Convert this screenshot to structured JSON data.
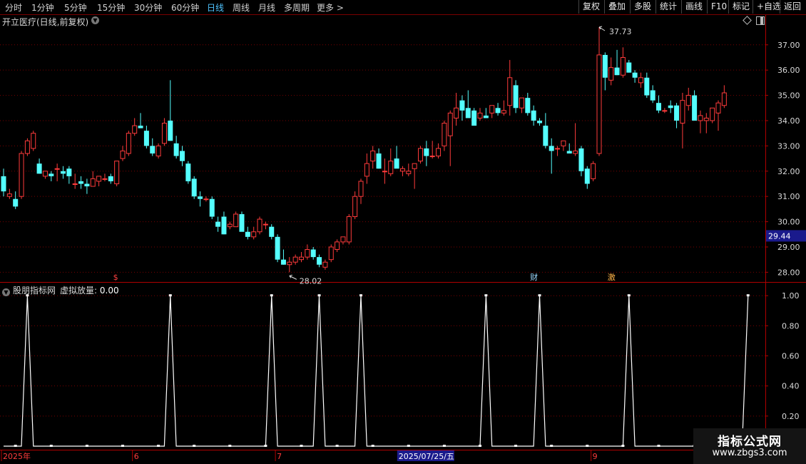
{
  "toolbar": {
    "periods": [
      "分时",
      "1分钟",
      "5分钟",
      "15分钟",
      "30分钟",
      "60分钟",
      "日线",
      "周线",
      "月线",
      "多周期",
      "更多 >"
    ],
    "active_period": "日线",
    "tools": [
      "复权",
      "叠加",
      "多股",
      "统计",
      "画线",
      "F10",
      "标记",
      "+自选",
      "返回"
    ]
  },
  "stock": {
    "title": "开立医疗(日线,前复权)"
  },
  "indicator": {
    "source": "股朋指标网",
    "name": "虚拟放量:",
    "value": "0.00"
  },
  "colors": {
    "up": "#ff3b3b",
    "down": "#54ffff",
    "grid": "#7a0000",
    "axis_text": "#d9d9d9",
    "line": "#ffffff"
  },
  "watermark": {
    "line1": "指标公式网",
    "line2": "www.zbgs3.com"
  },
  "chart_data": [
    {
      "type": "candlestick",
      "ylim": [
        27.7,
        37.7
      ],
      "y_ticks": [
        "28.00",
        "29.00",
        "30.00",
        "31.00",
        "32.00",
        "33.00",
        "34.00",
        "35.00",
        "36.00",
        "37.00"
      ],
      "price_marker": "29.44",
      "high_label": "37.73",
      "low_label": "28.02",
      "markers": [
        {
          "text": "$",
          "index": 19,
          "color": "#ff4040"
        },
        {
          "text": "财",
          "index": 89,
          "color": "#9ad8ff"
        },
        {
          "text": "激",
          "index": 102,
          "color": "#ffb347"
        }
      ],
      "candles": [
        [
          31.8,
          32.1,
          31.0,
          31.2
        ],
        [
          31.0,
          31.3,
          30.9,
          31.1
        ],
        [
          30.9,
          31.2,
          30.5,
          30.6
        ],
        [
          31.0,
          32.8,
          30.9,
          32.7
        ],
        [
          32.7,
          33.3,
          32.6,
          33.2
        ],
        [
          32.9,
          33.6,
          32.8,
          33.5
        ],
        [
          32.3,
          32.5,
          31.9,
          31.9
        ],
        [
          31.8,
          32.0,
          31.7,
          32.0
        ],
        [
          31.9,
          32.0,
          31.6,
          31.8
        ],
        [
          32.1,
          32.3,
          31.6,
          32.1
        ],
        [
          32.0,
          32.2,
          31.7,
          31.9
        ],
        [
          32.1,
          32.2,
          31.5,
          31.8
        ],
        [
          31.5,
          31.9,
          31.3,
          31.5
        ],
        [
          31.6,
          31.8,
          31.3,
          31.5
        ],
        [
          31.5,
          31.7,
          31.1,
          31.4
        ],
        [
          31.4,
          32.0,
          31.4,
          31.7
        ],
        [
          31.6,
          31.8,
          31.4,
          31.8
        ],
        [
          31.7,
          31.9,
          31.6,
          31.7
        ],
        [
          31.8,
          31.9,
          31.5,
          31.6
        ],
        [
          31.5,
          32.4,
          31.4,
          32.4
        ],
        [
          32.5,
          33.0,
          32.4,
          32.8
        ],
        [
          32.7,
          33.6,
          32.6,
          33.5
        ],
        [
          33.5,
          34.1,
          33.4,
          33.8
        ],
        [
          33.8,
          34.3,
          33.7,
          33.7
        ],
        [
          33.6,
          33.8,
          32.9,
          33.0
        ],
        [
          33.0,
          33.3,
          32.6,
          32.7
        ],
        [
          32.6,
          33.1,
          32.5,
          33.0
        ],
        [
          33.1,
          34.1,
          33.0,
          33.9
        ],
        [
          34.0,
          35.6,
          33.2,
          33.2
        ],
        [
          33.1,
          33.4,
          32.5,
          32.6
        ],
        [
          32.8,
          33.0,
          32.2,
          32.4
        ],
        [
          32.3,
          32.4,
          31.5,
          31.6
        ],
        [
          31.7,
          31.8,
          30.9,
          31.0
        ],
        [
          31.0,
          31.2,
          30.6,
          30.9
        ],
        [
          30.9,
          31.0,
          30.8,
          30.9
        ],
        [
          30.9,
          31.0,
          30.1,
          30.2
        ],
        [
          30.0,
          30.2,
          29.6,
          29.8
        ],
        [
          30.2,
          30.4,
          29.5,
          29.5
        ],
        [
          29.8,
          30.0,
          29.7,
          29.9
        ],
        [
          29.8,
          30.4,
          29.8,
          30.3
        ],
        [
          30.3,
          30.4,
          29.7,
          29.6
        ],
        [
          29.6,
          29.8,
          29.3,
          29.4
        ],
        [
          29.4,
          29.8,
          29.3,
          29.6
        ],
        [
          29.6,
          30.2,
          29.5,
          30.1
        ],
        [
          29.9,
          30.0,
          29.7,
          29.9
        ],
        [
          29.8,
          29.9,
          29.3,
          29.4
        ],
        [
          29.4,
          29.5,
          28.4,
          28.5
        ],
        [
          28.5,
          28.9,
          28.3,
          28.3
        ],
        [
          28.3,
          28.6,
          28.0,
          28.4
        ],
        [
          28.4,
          28.7,
          28.3,
          28.6
        ],
        [
          28.5,
          28.8,
          28.4,
          28.6
        ],
        [
          28.6,
          29.1,
          28.5,
          28.9
        ],
        [
          28.9,
          29.0,
          28.5,
          28.6
        ],
        [
          28.6,
          28.7,
          28.2,
          28.3
        ],
        [
          28.2,
          28.5,
          28.1,
          28.4
        ],
        [
          28.5,
          29.1,
          28.4,
          29.0
        ],
        [
          28.9,
          29.3,
          28.8,
          29.2
        ],
        [
          29.2,
          29.4,
          29.1,
          29.4
        ],
        [
          29.2,
          30.3,
          29.1,
          30.2
        ],
        [
          30.2,
          31.2,
          30.1,
          31.0
        ],
        [
          31.0,
          31.7,
          30.7,
          31.6
        ],
        [
          31.8,
          32.7,
          31.5,
          32.3
        ],
        [
          32.4,
          33.0,
          32.1,
          32.8
        ],
        [
          32.7,
          32.9,
          32.1,
          32.1
        ],
        [
          32.0,
          32.5,
          31.5,
          32.0
        ],
        [
          31.9,
          32.9,
          31.8,
          32.4
        ],
        [
          32.5,
          33.0,
          32.3,
          32.1
        ],
        [
          32.0,
          32.2,
          31.8,
          32.1
        ],
        [
          31.9,
          32.3,
          31.8,
          32.0
        ],
        [
          32.1,
          32.3,
          31.3,
          32.3
        ],
        [
          32.4,
          33.0,
          32.3,
          32.9
        ],
        [
          32.9,
          33.2,
          32.2,
          32.6
        ],
        [
          32.6,
          33.2,
          32.5,
          32.6
        ],
        [
          32.6,
          33.1,
          32.5,
          32.9
        ],
        [
          33.0,
          34.0,
          32.8,
          33.9
        ],
        [
          33.4,
          34.4,
          32.2,
          34.3
        ],
        [
          34.1,
          35.1,
          33.8,
          34.5
        ],
        [
          34.8,
          35.0,
          34.0,
          34.4
        ],
        [
          34.5,
          35.2,
          34.3,
          34.1
        ],
        [
          34.4,
          34.5,
          33.8,
          33.8
        ],
        [
          34.1,
          34.5,
          34.0,
          34.3
        ],
        [
          34.2,
          34.5,
          34.1,
          34.1
        ],
        [
          34.3,
          34.6,
          34.1,
          34.6
        ],
        [
          34.5,
          34.7,
          34.2,
          34.3
        ],
        [
          34.3,
          34.8,
          34.2,
          34.4
        ],
        [
          34.6,
          36.4,
          34.2,
          35.7
        ],
        [
          35.4,
          35.6,
          34.3,
          34.5
        ],
        [
          34.5,
          34.9,
          34.3,
          34.9
        ],
        [
          34.9,
          35.1,
          34.2,
          34.3
        ],
        [
          34.4,
          34.6,
          33.8,
          34.0
        ],
        [
          34.0,
          34.1,
          33.8,
          33.9
        ],
        [
          33.8,
          34.3,
          32.9,
          33.0
        ],
        [
          33.0,
          33.3,
          31.9,
          32.8
        ],
        [
          32.9,
          33.0,
          32.6,
          32.9
        ],
        [
          33.0,
          33.1,
          32.8,
          33.2
        ],
        [
          32.8,
          33.1,
          32.7,
          32.7
        ],
        [
          32.7,
          33.9,
          32.6,
          32.8
        ],
        [
          32.9,
          33.0,
          31.8,
          32.0
        ],
        [
          32.1,
          32.2,
          31.3,
          31.5
        ],
        [
          31.7,
          32.4,
          31.6,
          32.3
        ],
        [
          32.7,
          37.7,
          32.6,
          36.6
        ],
        [
          36.6,
          36.7,
          35.2,
          35.7
        ],
        [
          35.6,
          36.5,
          35.4,
          36.1
        ],
        [
          36.1,
          36.8,
          35.8,
          35.8
        ],
        [
          35.8,
          36.9,
          35.7,
          36.5
        ],
        [
          36.3,
          36.4,
          35.9,
          35.9
        ],
        [
          35.9,
          36.0,
          35.5,
          35.7
        ],
        [
          35.5,
          35.9,
          35.3,
          35.7
        ],
        [
          35.7,
          35.9,
          34.9,
          35.0
        ],
        [
          35.2,
          35.4,
          34.7,
          34.8
        ],
        [
          34.7,
          35.0,
          34.3,
          34.4
        ],
        [
          34.4,
          34.5,
          34.3,
          34.4
        ],
        [
          34.6,
          34.8,
          34.3,
          34.5
        ],
        [
          34.6,
          34.7,
          33.7,
          34.0
        ],
        [
          33.9,
          35.1,
          32.9,
          34.8
        ],
        [
          34.6,
          35.3,
          34.4,
          35.0
        ],
        [
          35.0,
          35.2,
          34.1,
          34.0
        ],
        [
          34.0,
          34.4,
          33.5,
          34.2
        ],
        [
          34.0,
          34.3,
          33.5,
          34.1
        ],
        [
          34.0,
          34.5,
          33.9,
          34.5
        ],
        [
          34.3,
          34.8,
          33.6,
          34.7
        ],
        [
          34.6,
          35.4,
          34.5,
          35.1
        ]
      ]
    },
    {
      "type": "line",
      "series_label": "虚拟放量",
      "ylim": [
        0,
        1.02
      ],
      "y_ticks": [
        "0.20",
        "0.40",
        "0.60",
        "0.80",
        "1.00"
      ],
      "x_labels": [
        {
          "text": "2025年",
          "index": 0
        },
        {
          "text": "6",
          "index": 22
        },
        {
          "text": "7",
          "index": 46
        },
        {
          "text": "2025/07/25/五",
          "index": 68,
          "highlight": true
        },
        {
          "text": "9",
          "index": 99
        }
      ],
      "spike_indices": [
        4,
        28,
        45,
        53,
        60,
        81,
        90,
        105,
        125
      ],
      "length": 126
    }
  ]
}
